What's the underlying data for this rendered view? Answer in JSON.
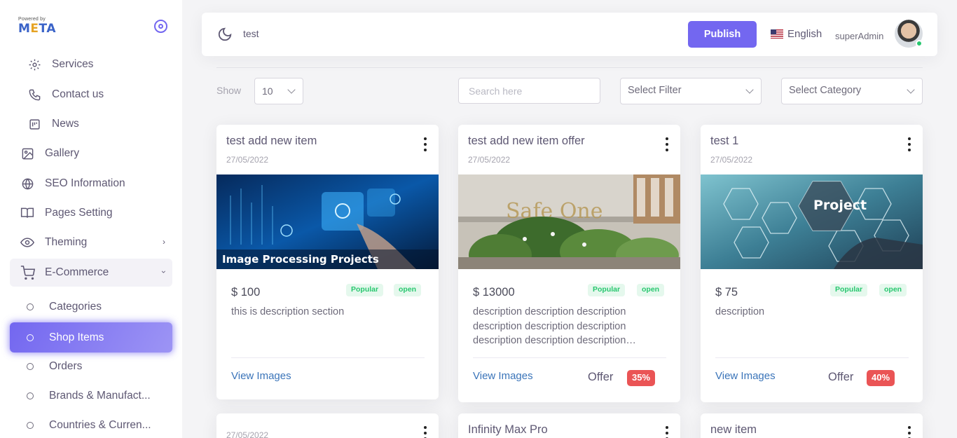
{
  "brand": {
    "powered": "Powered by",
    "logo_m": "M",
    "logo_e": "E",
    "logo_rest": "TA"
  },
  "sidebar": {
    "items": [
      {
        "label": "Services",
        "icon": "gear-icon"
      },
      {
        "label": "Contact us",
        "icon": "phone-icon"
      },
      {
        "label": "News",
        "icon": "news-icon"
      },
      {
        "label": "Gallery",
        "icon": "image-icon"
      },
      {
        "label": "SEO Information",
        "icon": "globe-icon"
      },
      {
        "label": "Pages Setting",
        "icon": "book-icon"
      },
      {
        "label": "Theming",
        "icon": "eye-icon"
      },
      {
        "label": "E-Commerce",
        "icon": "cart-icon"
      },
      {
        "label": "Categories"
      },
      {
        "label": "Shop Items"
      },
      {
        "label": "Orders"
      },
      {
        "label": "Brands & Manufact..."
      },
      {
        "label": "Countries & Curren..."
      }
    ]
  },
  "header": {
    "title": "test",
    "publish_label": "Publish",
    "language": "English",
    "user": "superAdmin"
  },
  "filters": {
    "show_label": "Show",
    "show_value": "10",
    "search_placeholder": "Search here",
    "filter_placeholder": "Select Filter",
    "category_placeholder": "Select Category"
  },
  "cards": [
    {
      "title": "test add new item",
      "date": "27/05/2022",
      "image_caption": "Image Processing Projects",
      "price": "$ 100",
      "badge_popular": "Popular",
      "badge_status": "open",
      "description": "this is description section",
      "link": "View Images"
    },
    {
      "title": "test add new item offer",
      "date": "27/05/2022",
      "image_caption": "Safe One",
      "price": "$ 13000",
      "badge_popular": "Popular",
      "badge_status": "open",
      "description": "description description description description description description description description description description",
      "link": "View Images",
      "offer_label": "Offer",
      "offer_value": "35%"
    },
    {
      "title": "test 1",
      "date": "27/05/2022",
      "image_caption": "Project",
      "price": "$ 75",
      "badge_popular": "Popular",
      "badge_status": "open",
      "description": "description",
      "link": "View Images",
      "offer_label": "Offer",
      "offer_value": "40%"
    },
    {
      "title": "",
      "date": "27/05/2022"
    },
    {
      "title": "Infinity Max Pro",
      "date": ""
    },
    {
      "title": "new item",
      "date": ""
    }
  ],
  "colors": {
    "accent": "#7367f0",
    "success": "#28c76f",
    "danger": "#ea5455",
    "link": "#3a74b9"
  }
}
